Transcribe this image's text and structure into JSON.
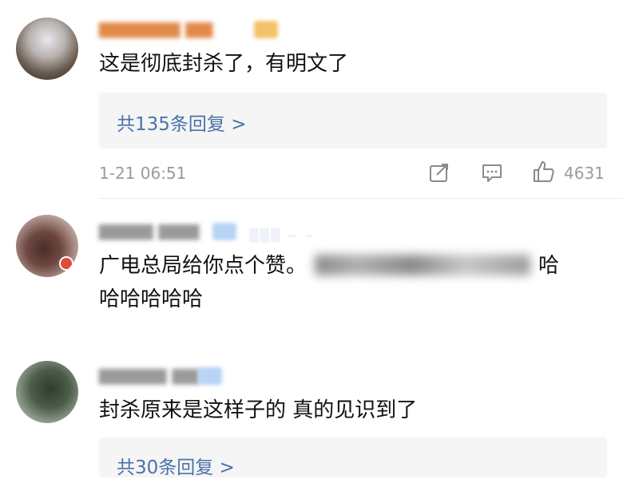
{
  "comments": [
    {
      "text": "这是彻底封杀了，有明文了",
      "reply_link": "共135条回复 >",
      "timestamp": "1-21 06:51",
      "likes": "4631",
      "icons": [
        "share-icon",
        "comment-icon",
        "like-icon"
      ]
    },
    {
      "text_before": "广电总局给你点个赞。",
      "text_after": "哈",
      "text_line2": "哈哈哈哈哈"
    },
    {
      "text": "封杀原来是这样子的 真的见识到了",
      "reply_link": "共30条回复 >"
    }
  ],
  "colors": {
    "link": "#4b72a8",
    "meta": "#9b9b9b",
    "reply_bg": "#f5f5f5"
  }
}
